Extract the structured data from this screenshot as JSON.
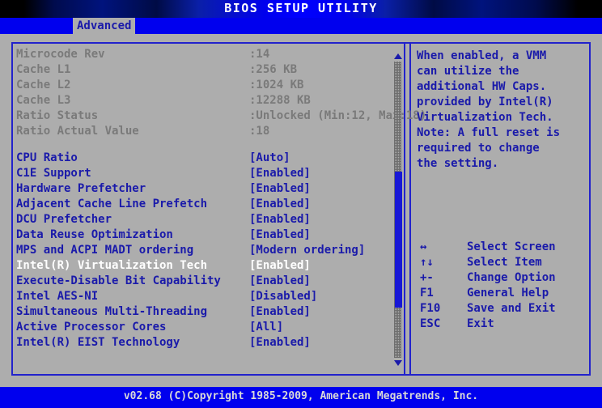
{
  "title": "BIOS SETUP UTILITY",
  "menu": {
    "active_tab": "Advanced"
  },
  "colors": {
    "background": "#adadad",
    "accent_blue": "#0000ee",
    "label_blue": "#1a1aaa",
    "dimmed_gray": "#7a7a7a",
    "selected_white": "#ffffff",
    "border": "#2222cc"
  },
  "info_rows": [
    {
      "label": "Microcode Rev",
      "value": ":14"
    },
    {
      "label": "Cache L1",
      "value": ":256 KB"
    },
    {
      "label": "Cache L2",
      "value": ":1024 KB"
    },
    {
      "label": "Cache L3",
      "value": ":12288 KB"
    },
    {
      "label": "Ratio Status",
      "value": ":Unlocked (Min:12, Max:18)"
    },
    {
      "label": "Ratio Actual Value",
      "value": ":18"
    }
  ],
  "option_rows": [
    {
      "label": "CPU Ratio",
      "value": "[Auto]",
      "selected": false
    },
    {
      "label": "C1E Support",
      "value": "[Enabled]",
      "selected": false
    },
    {
      "label": "Hardware Prefetcher",
      "value": "[Enabled]",
      "selected": false
    },
    {
      "label": "Adjacent Cache Line Prefetch",
      "value": "[Enabled]",
      "selected": false
    },
    {
      "label": "DCU Prefetcher",
      "value": "[Enabled]",
      "selected": false
    },
    {
      "label": "Data Reuse Optimization",
      "value": "[Enabled]",
      "selected": false
    },
    {
      "label": "MPS and ACPI MADT ordering",
      "value": "[Modern ordering]",
      "selected": false
    },
    {
      "label": "Intel(R) Virtualization Tech",
      "value": "[Enabled]",
      "selected": true
    },
    {
      "label": "Execute-Disable Bit Capability",
      "value": "[Enabled]",
      "selected": false
    },
    {
      "label": "Intel AES-NI",
      "value": "[Disabled]",
      "selected": false
    },
    {
      "label": "Simultaneous Multi-Threading",
      "value": "[Enabled]",
      "selected": false
    },
    {
      "label": "Active Processor Cores",
      "value": "[All]",
      "selected": false
    },
    {
      "label": "Intel(R) EIST Technology",
      "value": "[Enabled]",
      "selected": false
    }
  ],
  "help": {
    "lines": [
      "When enabled, a VMM",
      "can utilize the",
      "additional HW Caps.",
      "provided by Intel(R)",
      "Virtualization Tech.",
      "Note: A full reset is",
      "required to change",
      "the setting."
    ]
  },
  "key_legend": [
    {
      "key": "↔",
      "desc": "Select Screen"
    },
    {
      "key": "↑↓",
      "desc": "Select Item"
    },
    {
      "key": "+-",
      "desc": "Change Option"
    },
    {
      "key": "F1",
      "desc": "General Help"
    },
    {
      "key": "F10",
      "desc": "Save and Exit"
    },
    {
      "key": "ESC",
      "desc": "Exit"
    }
  ],
  "scrollbar": {
    "up_arrow": "scroll-up-arrow",
    "down_arrow": "scroll-down-arrow"
  },
  "footer": "v02.68 (C)Copyright 1985-2009, American Megatrends, Inc."
}
